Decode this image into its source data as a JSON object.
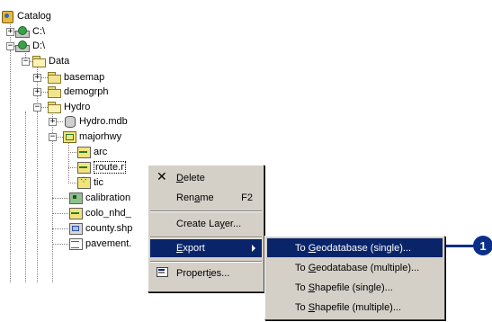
{
  "tree": {
    "catalog": "Catalog",
    "c_drive": "C:\\",
    "d_drive": "D:\\",
    "data": "Data",
    "basemap": "basemap",
    "demogrph": "demogrph",
    "hydro": "Hydro",
    "hydro_mdb": "Hydro.mdb",
    "majorhwy": "majorhwy",
    "arc": "arc",
    "route": "route.r",
    "tic": "tic",
    "calibration": "calibration",
    "colo_nhd": "colo_nhd_",
    "county": "county.shp",
    "pavement": "pavement."
  },
  "context_menu": {
    "delete": {
      "pre": "",
      "ul": "D",
      "post": "elete"
    },
    "rename": {
      "pre": "Ren",
      "ul": "a",
      "post": "me"
    },
    "rename_key": "F2",
    "create_layer": {
      "pre": "Create La",
      "ul": "y",
      "post": "er..."
    },
    "export": {
      "pre": "",
      "ul": "E",
      "post": "xport"
    },
    "properties": {
      "pre": "Propert",
      "ul": "i",
      "post": "es..."
    }
  },
  "export_submenu": [
    {
      "pre": "To ",
      "ul": "G",
      "post": "eodatabase (single)..."
    },
    {
      "pre": "To ",
      "ul": "G",
      "post": "eodatabase (multiple)..."
    },
    {
      "pre": "To ",
      "ul": "S",
      "post": "hapefile (single)..."
    },
    {
      "pre": "To ",
      "ul": "S",
      "post": "hapefile (multiple)..."
    }
  ],
  "callout": "1",
  "colors": {
    "highlight": "#0a246a",
    "menu_bg": "#d4d0c8",
    "callout": "#0a2f8a"
  },
  "icons": {
    "catalog": "catalog-icon",
    "drive": "drive-icon",
    "folder": "folder-icon",
    "database": "database-icon",
    "feature_dataset": "feature-dataset-icon",
    "line_fc": "line-feature-class-icon",
    "point_fc": "point-feature-class-icon",
    "delete": "delete-x-icon",
    "properties": "properties-icon",
    "submenu_arrow": "submenu-arrow-icon"
  }
}
